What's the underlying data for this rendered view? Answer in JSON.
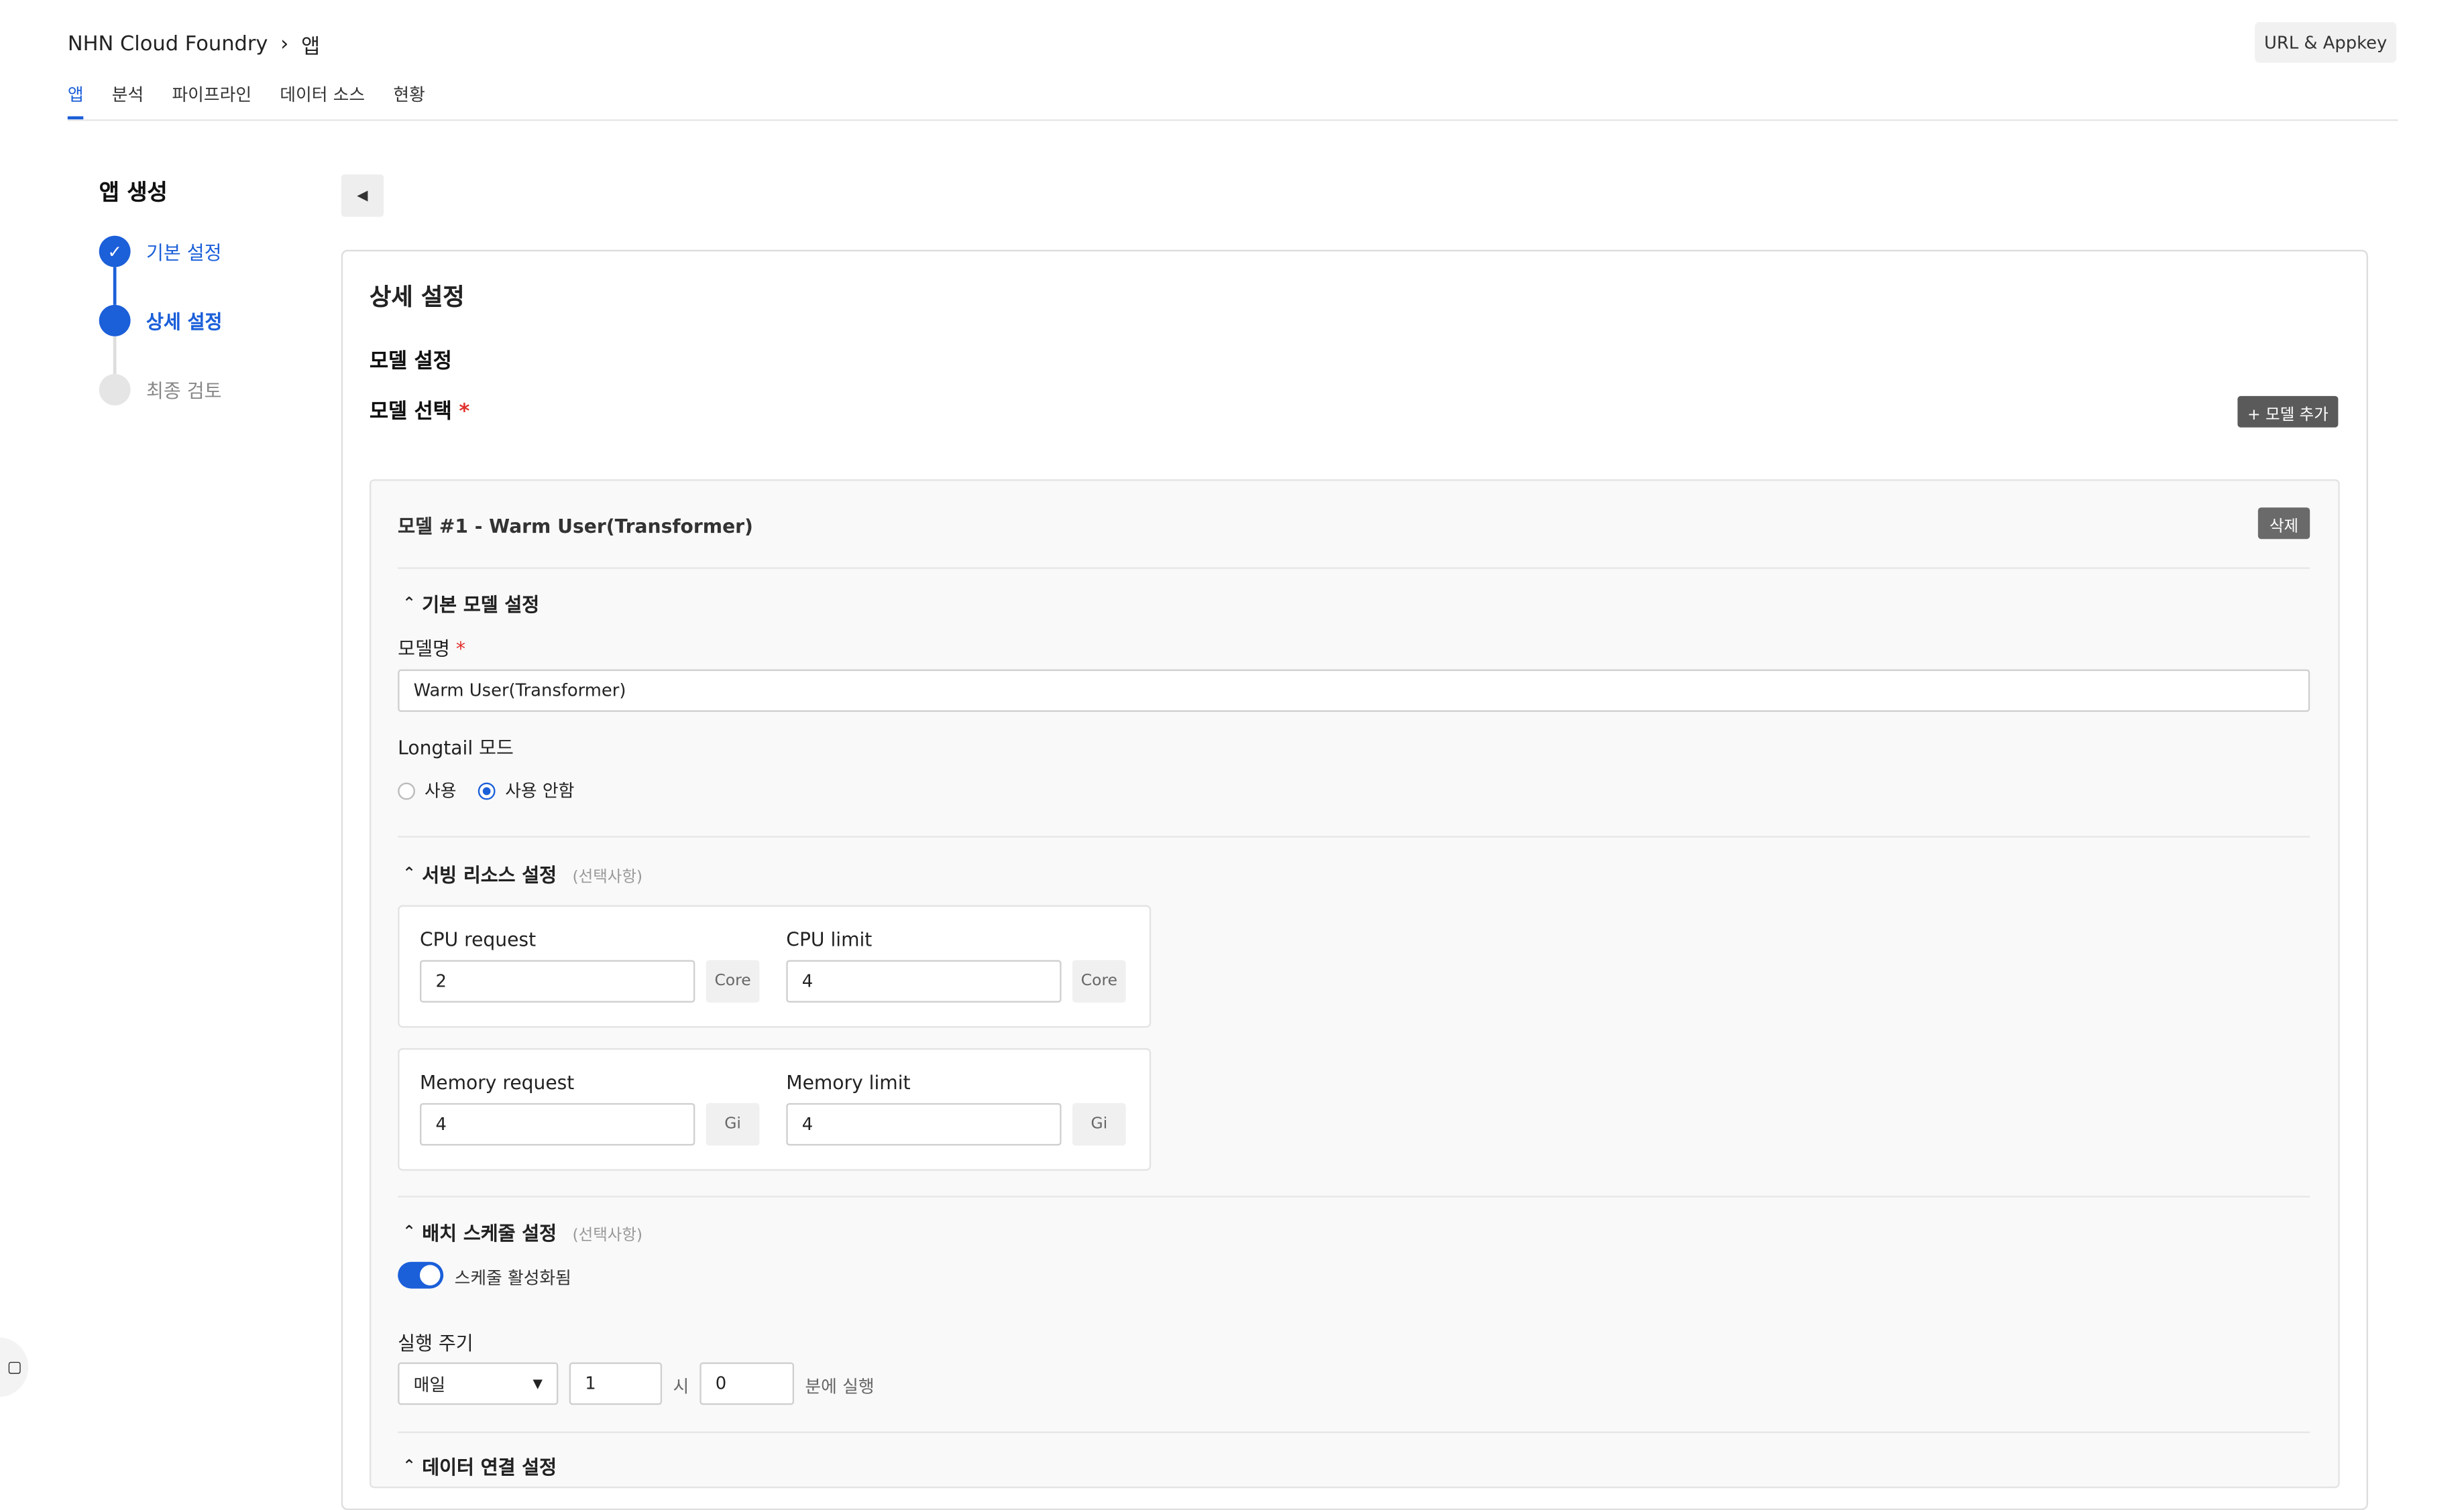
{
  "header": {
    "service": "NHN Cloud Foundry",
    "current": "앱",
    "url_button": "URL & Appkey"
  },
  "tabs": [
    "앱",
    "분석",
    "파이프라인",
    "데이터 소스",
    "현황"
  ],
  "sidebar": {
    "title": "앱 생성",
    "steps": [
      {
        "label": "기본 설정",
        "state": "done"
      },
      {
        "label": "상세 설정",
        "state": "active"
      },
      {
        "label": "최종 검토",
        "state": "pending"
      }
    ]
  },
  "colors": {
    "accent": "#1b5fd9",
    "required": "#e0302d"
  },
  "main": {
    "title": "상세 설정",
    "model_settings_title": "모델 설정",
    "model_select_label": "모델 선택",
    "required_mark": "*",
    "add_model_button": "+ 모델 추가",
    "model": {
      "title": "모델 #1 - Warm User(Transformer)",
      "delete_button": "삭제",
      "basic_section": "기본 모델 설정",
      "name_label": "모델명",
      "name_value": "Warm User(Transformer)",
      "longtail_label": "Longtail 모드",
      "longtail_options": [
        "사용",
        "사용 안함"
      ],
      "longtail_selected": "사용 안함",
      "serving_section": "서빙 리소스 설정",
      "optional": "(선택사항)",
      "cpu_request_label": "CPU request",
      "cpu_request_value": "2",
      "cpu_limit_label": "CPU limit",
      "cpu_limit_value": "4",
      "cpu_unit": "Core",
      "memory_request_label": "Memory request",
      "memory_request_value": "4",
      "memory_limit_label": "Memory limit",
      "memory_limit_value": "4",
      "memory_unit": "Gi",
      "batch_section": "배치 스케줄 설정",
      "schedule_toggle_label": "스케줄 활성화됨",
      "schedule_enabled": true,
      "run_cycle_label": "실행 주기",
      "cycle_value": "매일",
      "hour_value": "1",
      "hour_suffix": "시",
      "minute_value": "0",
      "minute_suffix": "분에 실행",
      "data_section": "데이터 연결 설정"
    }
  },
  "icons": {
    "breadcrumb_separator": "chevron-right-icon",
    "back": "caret-left-icon",
    "done_step": "check-icon",
    "section_toggle": "chevron-up-icon",
    "select_arrow": "caret-down-icon"
  }
}
